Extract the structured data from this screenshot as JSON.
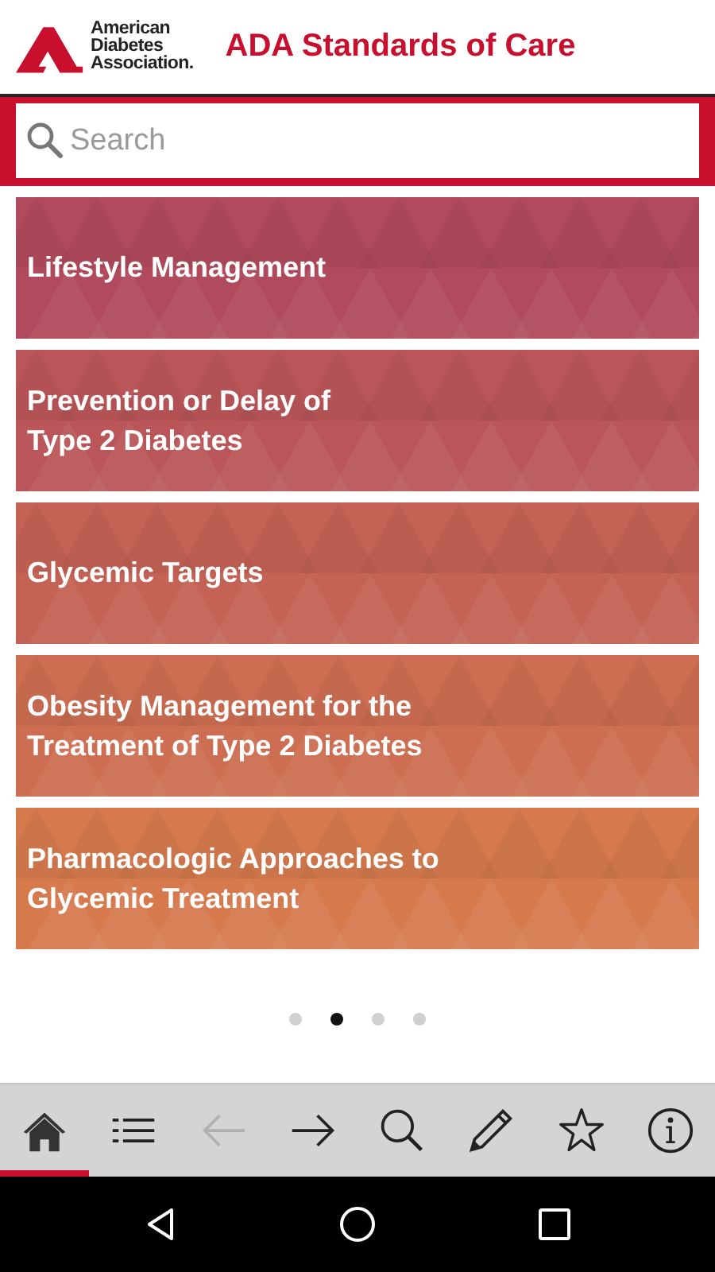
{
  "header": {
    "logo_lines": [
      "American",
      "Diabetes",
      "Association."
    ],
    "title": "ADA Standards of Care"
  },
  "search": {
    "placeholder": "Search"
  },
  "cards": [
    {
      "title": "Lifestyle Management"
    },
    {
      "title": "Prevention or Delay of\nType 2 Diabetes"
    },
    {
      "title": "Glycemic Targets"
    },
    {
      "title": "Obesity Management for the\nTreatment of Type 2 Diabetes"
    },
    {
      "title": "Pharmacologic Approaches to\nGlycemic Treatment"
    }
  ],
  "pager": [
    {
      "selected": false
    },
    {
      "selected": true
    },
    {
      "selected": false
    },
    {
      "selected": false
    }
  ],
  "toolbar": [
    {
      "kind": "home",
      "selected": true,
      "disabled": false
    },
    {
      "kind": "list",
      "selected": false,
      "disabled": false
    },
    {
      "kind": "back",
      "selected": false,
      "disabled": true
    },
    {
      "kind": "forward",
      "selected": false,
      "disabled": false
    },
    {
      "kind": "search",
      "selected": false,
      "disabled": false
    },
    {
      "kind": "edit",
      "selected": false,
      "disabled": false
    },
    {
      "kind": "star",
      "selected": false,
      "disabled": false
    },
    {
      "kind": "info",
      "selected": false,
      "disabled": false
    }
  ],
  "navbar": [
    {
      "kind": "back"
    },
    {
      "kind": "home"
    },
    {
      "kind": "recents"
    }
  ]
}
